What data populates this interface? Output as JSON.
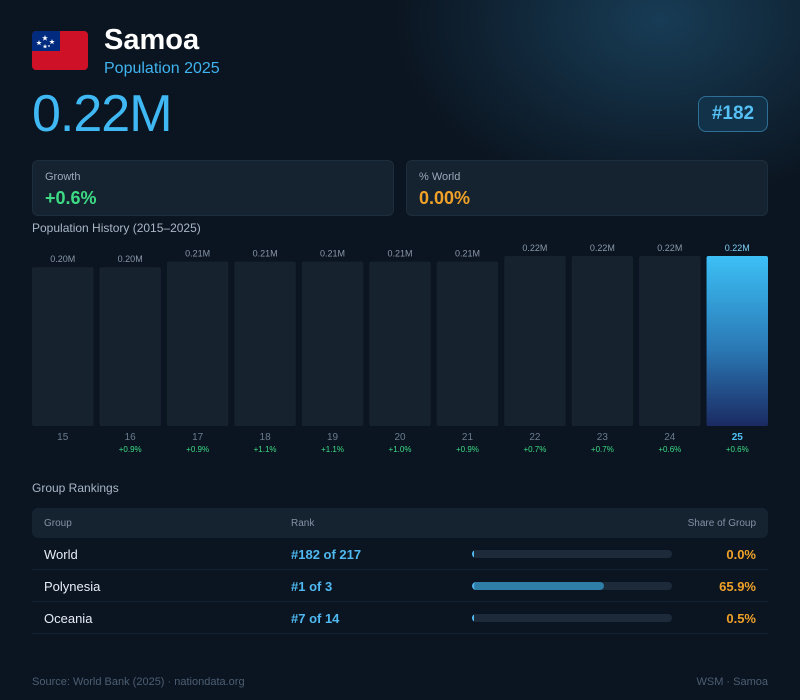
{
  "header": {
    "country": "Samoa",
    "subtitle": "Population 2025",
    "population": "0.22M",
    "rank_badge": "#182",
    "flag_icon": "samoa-flag-icon"
  },
  "stats": {
    "growth_label": "Growth",
    "growth_value": "+0.6%",
    "world_label": "% World",
    "world_value": "0.00%"
  },
  "colors": {
    "accent": "#3fb8f4",
    "growth": "#3ddc84",
    "world": "#f0a128"
  },
  "chart_data": {
    "type": "bar",
    "title": "Population History (2015–2025)",
    "categories": [
      "15",
      "16",
      "17",
      "18",
      "19",
      "20",
      "21",
      "22",
      "23",
      "24",
      "25"
    ],
    "values": [
      0.2,
      0.2,
      0.21,
      0.21,
      0.21,
      0.21,
      0.21,
      0.22,
      0.22,
      0.22,
      0.22
    ],
    "value_labels": [
      "0.20M",
      "0.20M",
      "0.21M",
      "0.21M",
      "0.21M",
      "0.21M",
      "0.21M",
      "0.22M",
      "0.22M",
      "0.22M",
      "0.22M"
    ],
    "growth_labels": [
      "",
      "+0.9%",
      "+0.9%",
      "+1.1%",
      "+1.1%",
      "+1.0%",
      "+0.9%",
      "+0.7%",
      "+0.7%",
      "+0.6%",
      "+0.6%"
    ],
    "highlight": "25"
  },
  "rankings": {
    "title": "Group Rankings",
    "headers": {
      "group": "Group",
      "rank": "Rank",
      "share": "Share of Group"
    },
    "rows": [
      {
        "group": "World",
        "rank": "#182 of 217",
        "share": "0.0%",
        "share_value": 0.0
      },
      {
        "group": "Polynesia",
        "rank": "#1 of 3",
        "share": "65.9%",
        "share_value": 65.9
      },
      {
        "group": "Oceania",
        "rank": "#7 of 14",
        "share": "0.5%",
        "share_value": 0.5
      }
    ]
  },
  "footer": {
    "source": "Source: World Bank (2025) · nationdata.org",
    "right": "WSM · Samoa"
  }
}
